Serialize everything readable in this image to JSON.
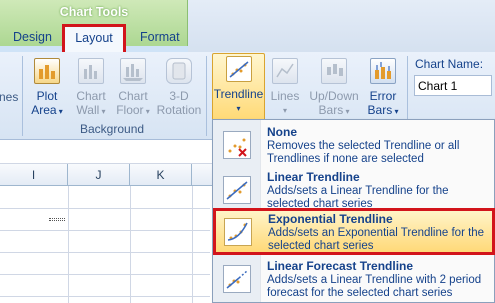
{
  "tabs": {
    "context_group": "Chart Tools",
    "design": "Design",
    "layout": "Layout",
    "format": "Format"
  },
  "ribbon": {
    "partial_label": "nes",
    "plot_area": [
      "Plot",
      "Area"
    ],
    "chart_wall": [
      "Chart",
      "Wall"
    ],
    "chart_floor": [
      "Chart",
      "Floor"
    ],
    "rotation_3d": [
      "3-D",
      "Rotation"
    ],
    "background_group": "Background",
    "trendline": "Trendline",
    "lines": "Lines",
    "updown_bars": [
      "Up/Down",
      "Bars"
    ],
    "error_bars": [
      "Error",
      "Bars"
    ],
    "chart_name_label": "Chart Name:",
    "chart_name_value": "Chart 1",
    "dropdown_arrow": "▾"
  },
  "sheet": {
    "columns": [
      "I",
      "J",
      "K"
    ]
  },
  "trendline_menu": [
    {
      "title": "None",
      "desc": "Removes the selected Trendline or all Trendlines if none are selected"
    },
    {
      "title": "Linear Trendline",
      "desc": "Adds/sets a Linear Trendline for the selected chart series"
    },
    {
      "title": "Exponential Trendline",
      "desc": "Adds/sets an Exponential Trendline for the selected chart series"
    },
    {
      "title": "Linear Forecast Trendline",
      "desc": "Adds/sets a Linear Trendline with 2 period forecast for the selected chart series"
    }
  ],
  "colors": {
    "highlight_border": "#d2141b",
    "context_tab": "#a8d58d",
    "menu_hover": "#ffd978"
  }
}
